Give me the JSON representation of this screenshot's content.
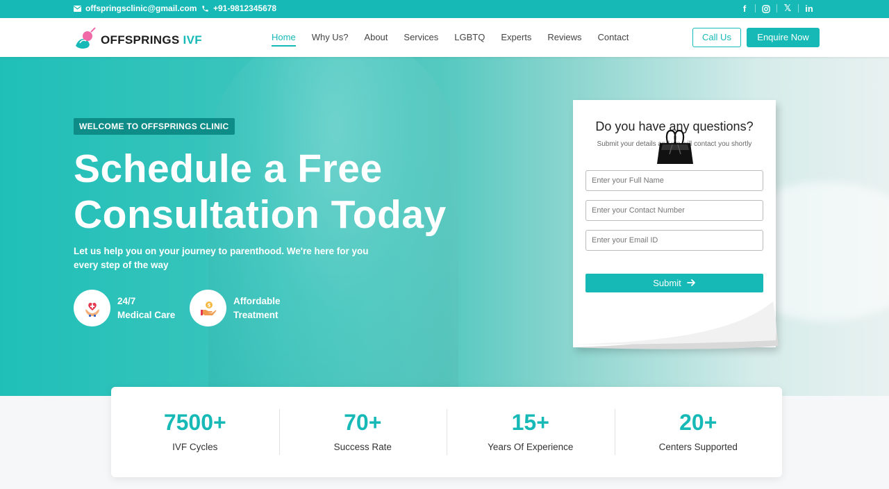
{
  "topbar": {
    "email": "offspringsclinic@gmail.com",
    "phone": "+91-9812345678",
    "socials": [
      "facebook-icon",
      "instagram-icon",
      "x-icon",
      "linkedin-icon"
    ]
  },
  "header": {
    "logo_main": "OFFSPRINGS ",
    "logo_accent": "IVF",
    "nav": [
      "Home",
      "Why Us?",
      "About",
      "Services",
      "LGBTQ",
      "Experts",
      "Reviews",
      "Contact"
    ],
    "call_label": "Call Us",
    "enquire_label": "Enquire Now"
  },
  "hero": {
    "tag": "WELCOME TO OFFSPRINGS CLINIC",
    "title_line1": "Schedule a Free",
    "title_line2": "Consultation Today",
    "subtitle": "Let us help you on your journey to parenthood. We're here for you every step of the way",
    "feature1_line1": "24/7",
    "feature1_line2": "Medical Care",
    "feature2_line1": "Affordable",
    "feature2_line2": "Treatment"
  },
  "form": {
    "title": "Do you have any questions?",
    "subtitle": "Submit your details and we will contact you shortly",
    "name_placeholder": "Enter your Full Name",
    "phone_placeholder": "Enter your Contact Number",
    "email_placeholder": "Enter your Email ID",
    "submit_label": "Submit"
  },
  "stats": [
    {
      "value": "7500+",
      "label": "IVF Cycles"
    },
    {
      "value": "70+",
      "label": "Success Rate"
    },
    {
      "value": "15+",
      "label": "Years Of Experience"
    },
    {
      "value": "20+",
      "label": "Centers Supported"
    }
  ],
  "colors": {
    "accent": "#16b9b6",
    "tag_bg": "#0e8c88"
  }
}
